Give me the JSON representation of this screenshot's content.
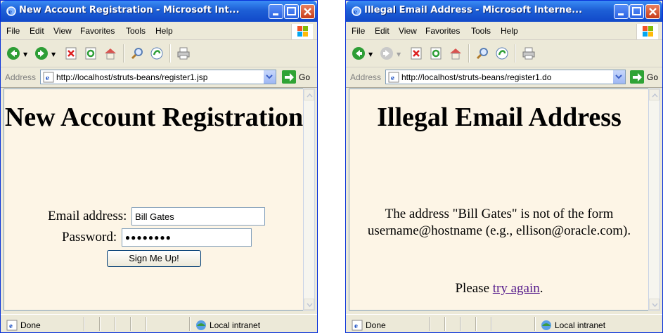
{
  "left": {
    "title": "New Account Registration - Microsoft Int...",
    "menu": [
      "File",
      "Edit",
      "View",
      "Favorites",
      "Tools",
      "Help"
    ],
    "address_label": "Address",
    "url": "http://localhost/struts-beans/register1.jsp",
    "go_label": "Go",
    "page": {
      "heading": "New Account Registration",
      "email_label": "Email address:",
      "email_value": "Bill Gates",
      "password_label": "Password:",
      "password_value": "●●●●●●●●",
      "submit_label": "Sign Me Up!"
    },
    "status_text": "Done",
    "zone": "Local intranet"
  },
  "right": {
    "title": "Illegal Email Address - Microsoft Interne...",
    "menu": [
      "File",
      "Edit",
      "View",
      "Favorites",
      "Tools",
      "Help"
    ],
    "address_label": "Address",
    "url": "http://localhost/struts-beans/register1.do",
    "go_label": "Go",
    "page": {
      "heading": "Illegal Email Address",
      "message": "The address \"Bill Gates\" is not of the form username@hostname (e.g., ellison@oracle.com).",
      "retry_prefix": "Please ",
      "retry_link": "try again",
      "retry_suffix": "."
    },
    "status_text": "Done",
    "zone": "Local intranet"
  },
  "colors": {
    "titlebar": "#1d5fd6",
    "page_background": "#fdf5e6",
    "link": "#551a8b"
  }
}
